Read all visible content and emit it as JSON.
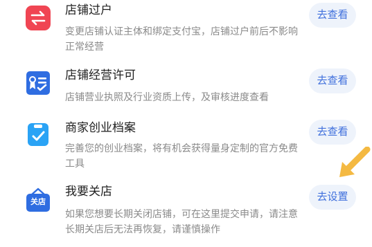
{
  "items": [
    {
      "icon": "transfer-arrows-icon",
      "icon_color": "#f04553",
      "title": "店铺过户",
      "description": "变更店铺认证主体和绑定支付宝，店铺过户前后不影响正常经营",
      "button": "去查看"
    },
    {
      "icon": "license-certificate-icon",
      "icon_color": "#2f6de1",
      "title": "店铺经营许可",
      "description": "店铺营业执照及行业资质上传，及审核进度查看",
      "button": "去查看"
    },
    {
      "icon": "clipboard-check-icon",
      "icon_color": "#2aa3f5",
      "title": "商家创业档案",
      "description": "完善您的创业档案，将有机会获得量身定制的官方免费工具",
      "button": "去查看"
    },
    {
      "icon": "close-store-icon",
      "icon_color": "#2f6de1",
      "icon_text": "关店",
      "title": "我要关店",
      "description": "如果您想要长期关闭店铺，可在这里提交申请，请注意长期关店后无法再恢复，请谨慎操作",
      "button": "去设置"
    }
  ],
  "accent_color": "#3f6fdc",
  "button_bg": "#eef3fb",
  "arrow_color": "#f4b942"
}
